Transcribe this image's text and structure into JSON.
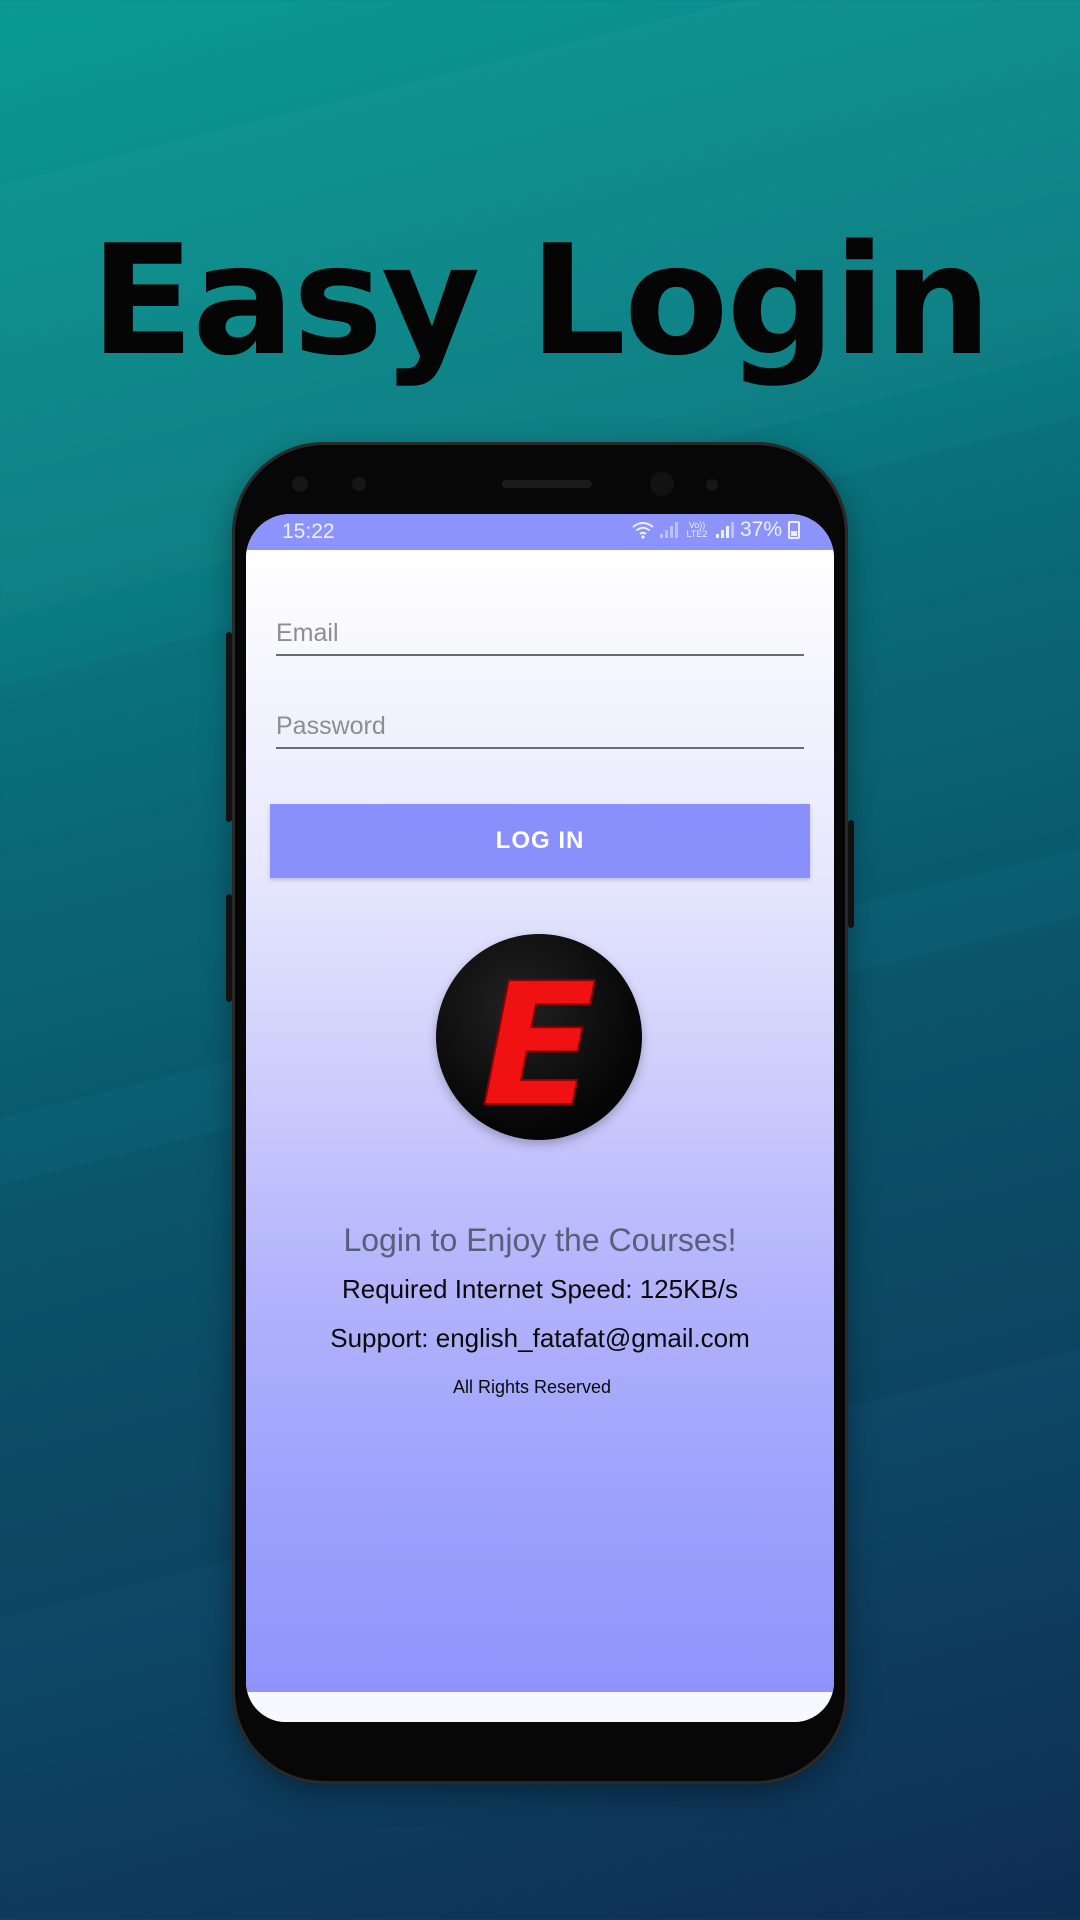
{
  "headline": "Easy Login",
  "status_bar": {
    "time": "15:22",
    "network_label": "Vo)) LTE2",
    "battery": "37%",
    "icons": [
      "wifi-icon",
      "signal-icon",
      "signal-icon",
      "battery-icon"
    ]
  },
  "login_form": {
    "email_placeholder": "Email",
    "email_value": "",
    "password_placeholder": "Password",
    "password_value": "",
    "login_button": "LOG IN"
  },
  "logo_letter": "E",
  "info": {
    "tagline": "Login to Enjoy the Courses!",
    "speed": "Required Internet Speed: 125KB/s",
    "support": "Support: english_fatafat@gmail.com",
    "rights": "All Rights Reserved"
  },
  "colors": {
    "accent": "#8a90fb",
    "logo_red": "#f01212",
    "headline": "#050505"
  }
}
